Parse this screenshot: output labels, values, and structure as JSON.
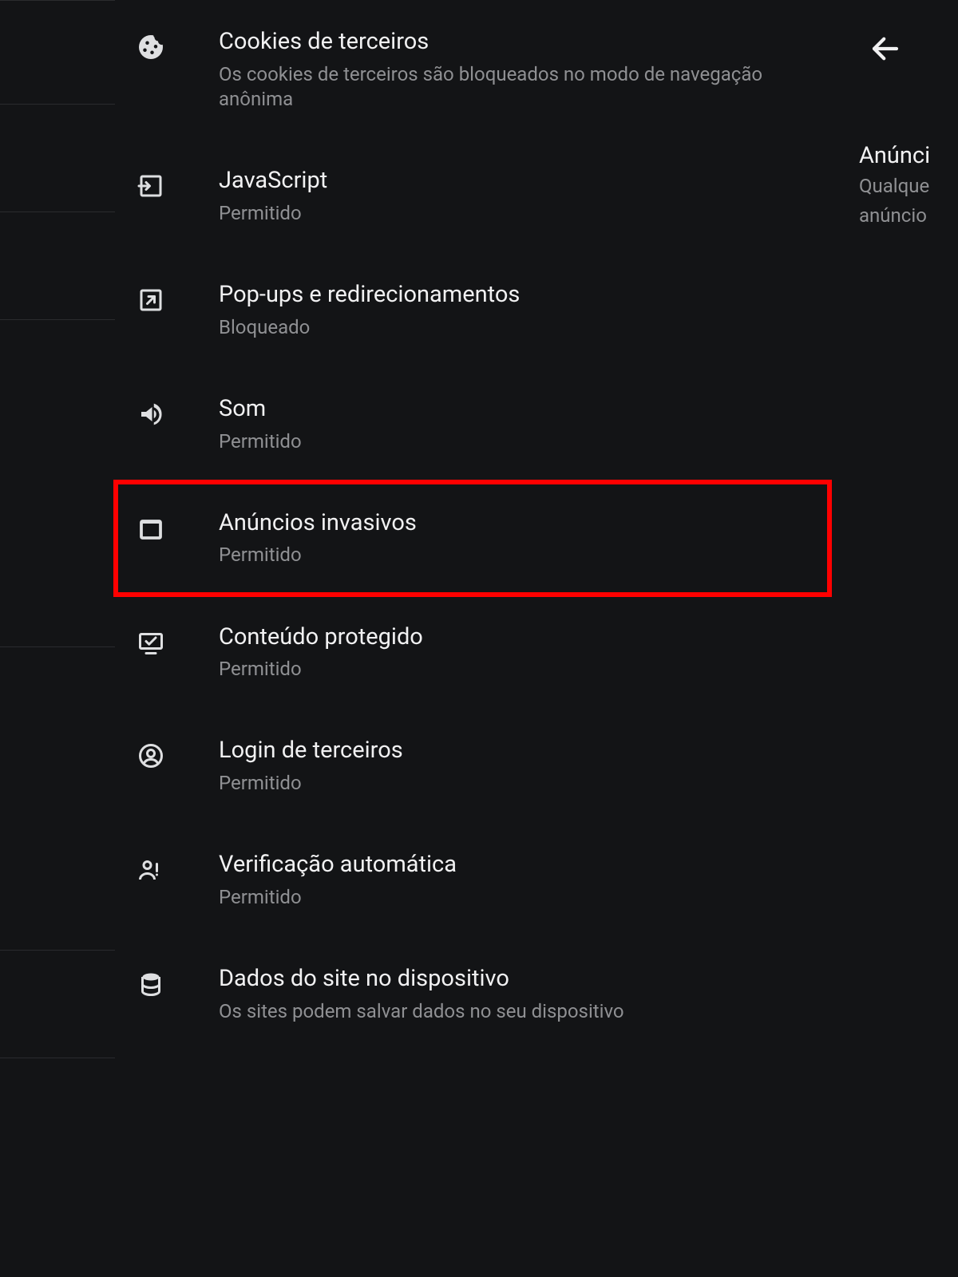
{
  "settings": [
    {
      "title": "Cookies de terceiros",
      "sub": "Os cookies de terceiros são bloqueados no modo de navegação anônima",
      "icon": "cookie-icon",
      "highlight": false
    },
    {
      "title": "JavaScript",
      "sub": "Permitido",
      "icon": "login-arrow-box-icon",
      "highlight": false
    },
    {
      "title": "Pop-ups e redirecionamentos",
      "sub": "Bloqueado",
      "icon": "open-in-new-icon",
      "highlight": false
    },
    {
      "title": "Som",
      "sub": "Permitido",
      "icon": "volume-icon",
      "highlight": false
    },
    {
      "title": "Anúncios invasivos",
      "sub": "Permitido",
      "icon": "ads-box-icon",
      "highlight": true
    },
    {
      "title": "Conteúdo protegido",
      "sub": "Permitido",
      "icon": "protected-monitor-icon",
      "highlight": false
    },
    {
      "title": "Login de terceiros",
      "sub": "Permitido",
      "icon": "account-circle-icon",
      "highlight": false
    },
    {
      "title": "Verificação automática",
      "sub": "Permitido",
      "icon": "verify-person-icon",
      "highlight": false
    },
    {
      "title": "Dados do site no dispositivo",
      "sub": "Os sites podem salvar dados no seu dispositivo",
      "icon": "database-icon",
      "highlight": false
    }
  ],
  "right_peek": {
    "top": "Anúnci",
    "line1": "Qualque",
    "line2": "anúncio"
  },
  "left_sep_tops": [
    0,
    130,
    265,
    400,
    810,
    1190,
    1325
  ]
}
